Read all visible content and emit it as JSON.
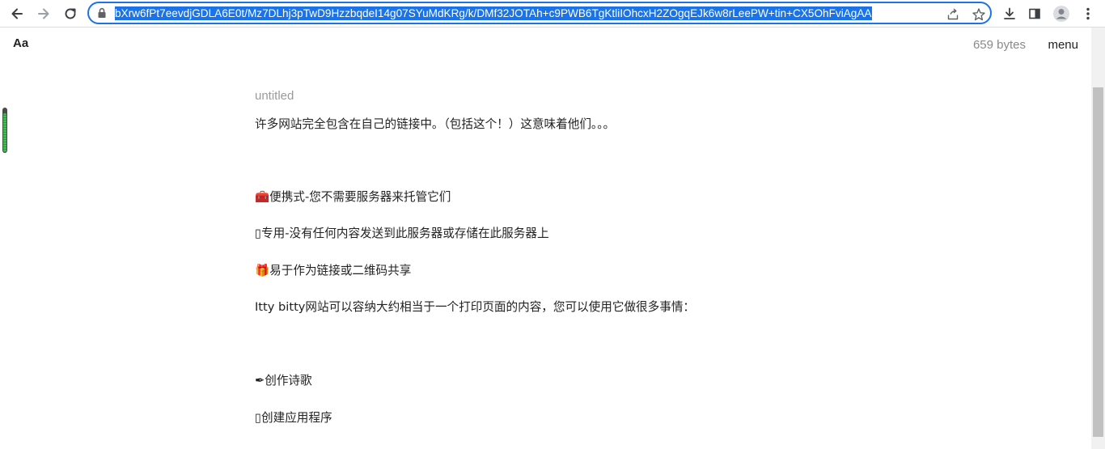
{
  "browser": {
    "url": "bXrw6fPt7eevdjGDLA6E0t/Mz7DLhj3pTwD9HzzbqdeI14g07SYuMdKRg/k/DMf32JOTAh+c9PWB6TgKtliIOhcxH2ZOgqEJk6w8rLeePW+tin+CX5OhFviAgAA",
    "icons": {
      "back": "arrow-left-icon",
      "forward": "arrow-right-icon",
      "reload": "reload-icon",
      "lock": "lock-icon",
      "share": "share-icon",
      "bookmark": "star-icon",
      "download": "download-icon",
      "side_panel": "side-panel-icon",
      "profile": "profile-icon",
      "menu": "more-vert-icon"
    },
    "accent_color": "#1a73e8"
  },
  "page": {
    "font_toggle": "Aa",
    "byte_count": "659 bytes",
    "menu_label": "menu",
    "compression_fraction": 0.88,
    "title_placeholder": "untitled",
    "lines": [
      "许多网站完全包含在自己的链接中。（包括这个！）这意味着他们。。。",
      "🧰便携式-您不需要服务器来托管它们",
      "▯专用-没有任何内容发送到此服务器或存储在此服务器上",
      "🎁易于作为链接或二维码共享",
      "Itty bitty网站可以容纳大约相当于一个打印页面的内容，您可以使用它做很多事情：",
      "✒创作诗歌",
      "▯创建应用程序"
    ]
  },
  "scrollbar": {
    "thumb_fraction": 0.88
  }
}
